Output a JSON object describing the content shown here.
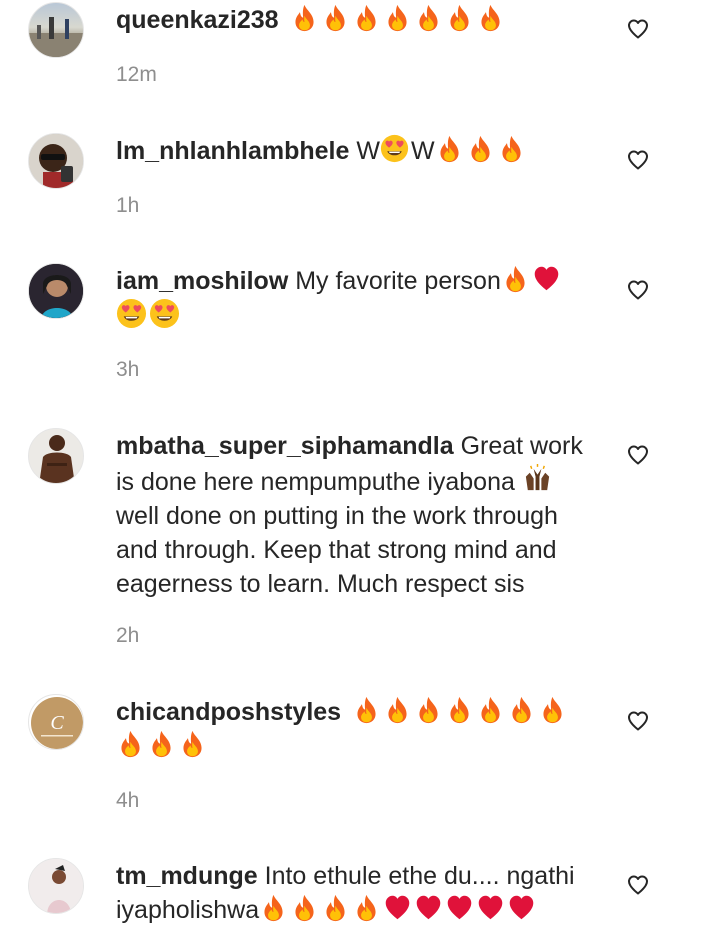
{
  "comments": [
    {
      "username": "queenkazi238",
      "text": "",
      "emoji_sequence": "fire x7",
      "time": "12m",
      "avatar_icon": "avatar-road-photo",
      "like_icon": "heart-outline-icon"
    },
    {
      "username": "lm_nhlanhlambhele",
      "text": "W😍W🔥🔥🔥",
      "time": "1h",
      "avatar_icon": "avatar-man-glasses",
      "like_icon": "heart-outline-icon"
    },
    {
      "username": "iam_moshilow",
      "text": "My favorite person",
      "emoji_sequence": "fire heart / heart-eyes x2",
      "time": "3h",
      "avatar_icon": "avatar-woman-portrait",
      "like_icon": "heart-outline-icon"
    },
    {
      "username": "mbatha_super_siphamandla",
      "text_1": "Great work is done here nempumputhe iyabona",
      "text_2": "well done on putting in the work through and through. Keep that strong mind and eagerness to learn. Much respect sis",
      "emoji_sequence": "raising-hands",
      "time": "2h",
      "avatar_icon": "avatar-man-shirtless",
      "like_icon": "heart-outline-icon"
    },
    {
      "username": "chicandposhstyles",
      "text": "",
      "emoji_sequence": "fire x10",
      "time": "4h",
      "avatar_icon": "avatar-logo-c",
      "like_icon": "heart-outline-icon"
    },
    {
      "username": "tm_mdunge",
      "text": "Into ethule ethe du.... ngathi iyapholishwa",
      "emoji_sequence": "fire x4 heart x5",
      "time": "",
      "avatar_icon": "avatar-woman-light",
      "like_icon": "heart-outline-icon"
    }
  ],
  "colors": {
    "text": "#262626",
    "muted": "#8e8e8e",
    "fire": "#f5641b",
    "heart": "#e0123a"
  }
}
